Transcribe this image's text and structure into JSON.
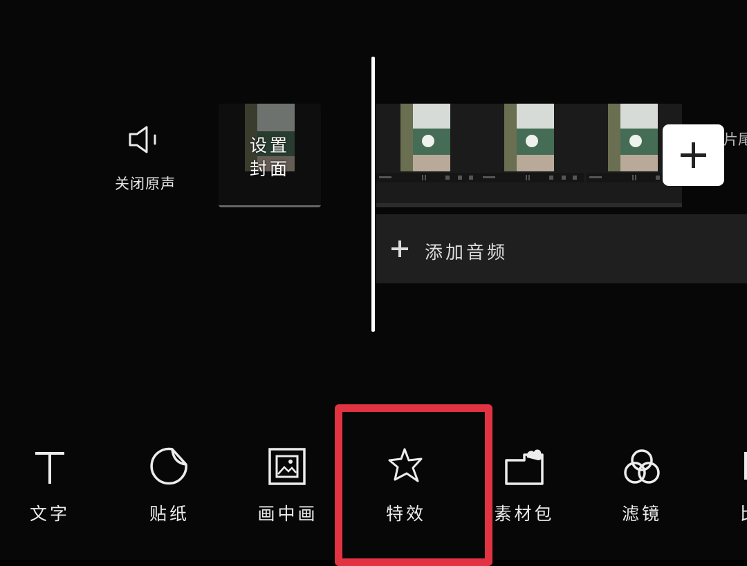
{
  "timeline": {
    "mute_label": "关闭原声",
    "cover_label_line1": "设置",
    "cover_label_line2": "封面",
    "end_label": "片尾",
    "audio_label": "添加音频"
  },
  "toolbar": {
    "items": [
      {
        "label": "文字",
        "icon": "text-icon"
      },
      {
        "label": "贴纸",
        "icon": "sticker-icon"
      },
      {
        "label": "画中画",
        "icon": "picture-in-picture-icon"
      },
      {
        "label": "特效",
        "icon": "effects-star-icon"
      },
      {
        "label": "素材包",
        "icon": "material-pack-icon"
      },
      {
        "label": "滤镜",
        "icon": "filter-icon"
      },
      {
        "label": "比",
        "icon": "ratio-icon"
      }
    ],
    "highlighted": "特效"
  },
  "colors": {
    "highlight": "#e13341",
    "background": "#070707",
    "track": "#1f1f1f"
  }
}
